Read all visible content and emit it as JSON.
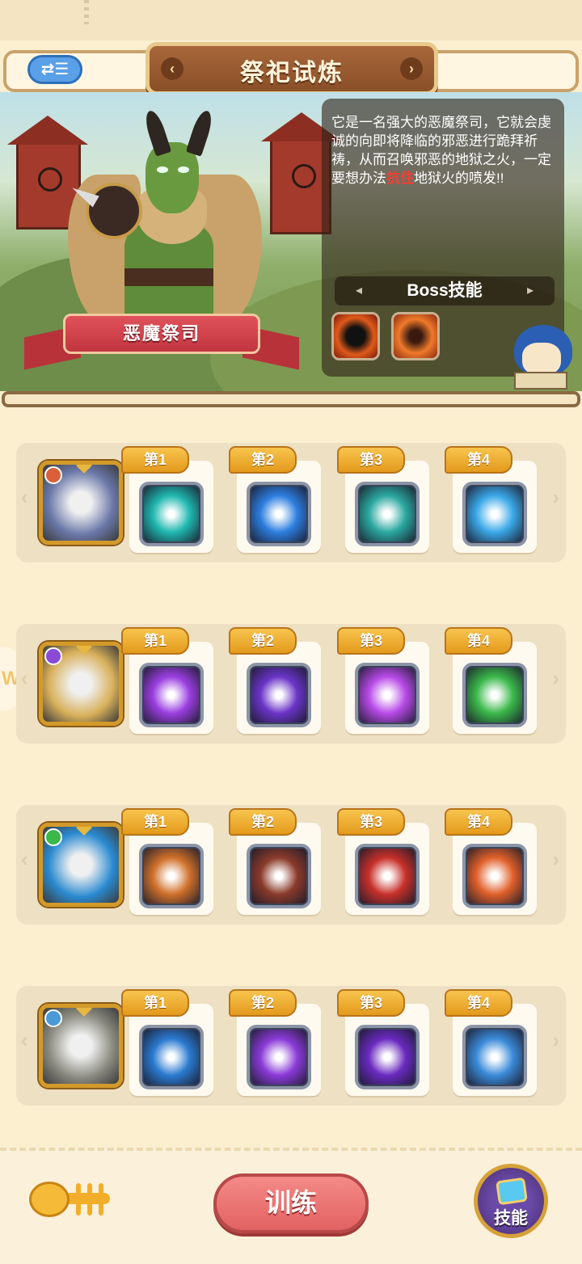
{
  "header": {
    "title": "祭祀试炼",
    "swap_label": "⇄☰",
    "left_chevron": "‹",
    "right_chevron": "›"
  },
  "boss": {
    "name": "恶魔祭司",
    "description_part1": "它是一名强大的恶魔祭司，它就会虔诚的向即将降临的邪恶进行跪拜祈祷，从而召唤邪恶的地狱之火，一定要想办法",
    "description_highlight": "抗住",
    "description_part2": "地狱火的喷发!!",
    "skills_title": "Boss技能",
    "skill_icons": [
      "demon-silhouette-icon",
      "fire-summon-icon"
    ]
  },
  "heroes": [
    {
      "portrait": "armored-penguin-icon",
      "class_color": "#d9603a",
      "slots": [
        {
          "label": "第1",
          "icon": "shadow-ghost-icon",
          "color": "#1fb8b0"
        },
        {
          "label": "第2",
          "icon": "blue-blade-icon",
          "color": "#2c7ee0"
        },
        {
          "label": "第3",
          "icon": "hammer-icon",
          "color": "#2aa8a0"
        },
        {
          "label": "第4",
          "icon": "wave-hand-icon",
          "color": "#3aa8e8"
        }
      ]
    },
    {
      "portrait": "crowned-princess-icon",
      "class_color": "#8a4ad6",
      "slots": [
        {
          "label": "第1",
          "icon": "purple-slash-icon",
          "color": "#9a3ee0"
        },
        {
          "label": "第2",
          "icon": "snake-altar-icon",
          "color": "#6a34c8"
        },
        {
          "label": "第3",
          "icon": "winged-shield-icon",
          "color": "#b84ae8"
        },
        {
          "label": "第4",
          "icon": "green-heal-icon",
          "color": "#3ab84a"
        }
      ]
    },
    {
      "portrait": "blue-fish-icon",
      "class_color": "#3ab84a",
      "slots": [
        {
          "label": "第1",
          "icon": "feather-fan-icon",
          "color": "#d0702a"
        },
        {
          "label": "第2",
          "icon": "crossbow-icon",
          "color": "#8a3a2a"
        },
        {
          "label": "第3",
          "icon": "mace-swing-icon",
          "color": "#c8302a"
        },
        {
          "label": "第4",
          "icon": "bonfire-icon",
          "color": "#e0602a"
        }
      ]
    },
    {
      "portrait": "bandaged-bird-icon",
      "class_color": "#4a9ad6",
      "slots": [
        {
          "label": "第1",
          "icon": "ice-shards-icon",
          "color": "#2a7ad0"
        },
        {
          "label": "第2",
          "icon": "violet-bolts-icon",
          "color": "#8a3ad8"
        },
        {
          "label": "第3",
          "icon": "eye-crystal-icon",
          "color": "#6a2ac0"
        },
        {
          "label": "第4",
          "icon": "frost-crystal-icon",
          "color": "#3a8ad8"
        }
      ]
    }
  ],
  "bottom": {
    "fish_icon": "fish-bone-icon",
    "train_label": "训练",
    "skill_label": "技能",
    "peek_glyph": "W"
  }
}
